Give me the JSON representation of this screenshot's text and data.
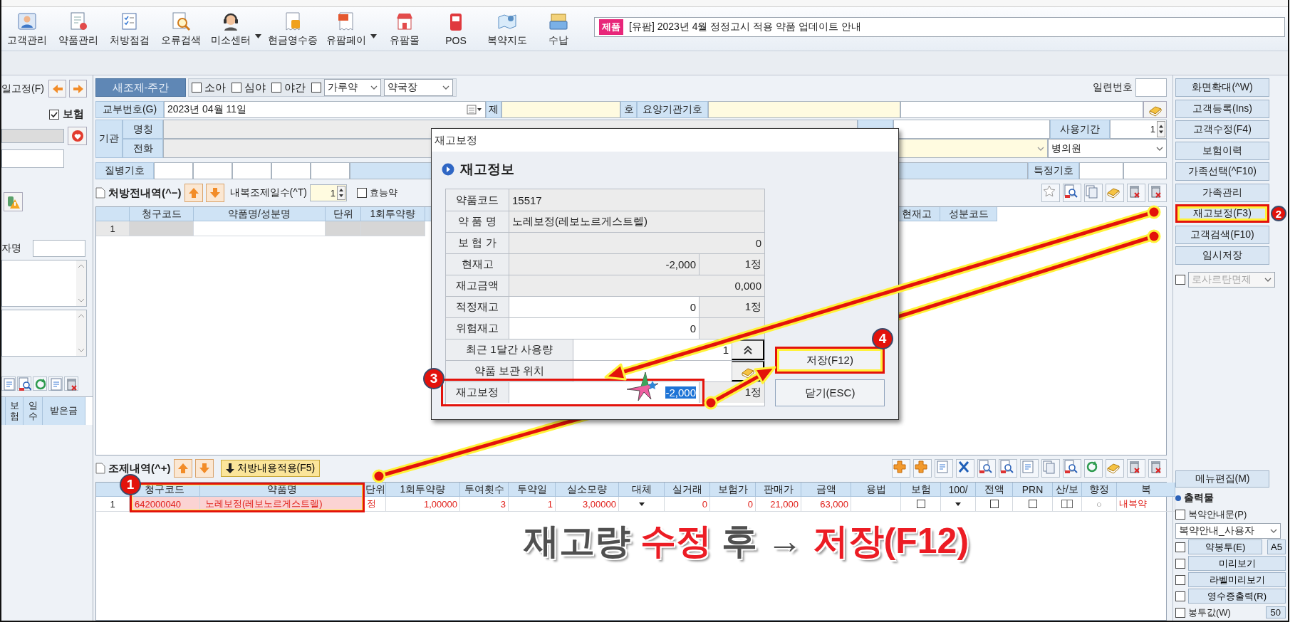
{
  "toolbar": {
    "items": [
      {
        "label": "고객관리",
        "dropdown": false
      },
      {
        "label": "약품관리",
        "dropdown": false
      },
      {
        "label": "처방점검",
        "dropdown": false
      },
      {
        "label": "오류검색",
        "dropdown": false
      },
      {
        "label": "미소센터",
        "dropdown": true
      },
      {
        "label": "현금영수증",
        "dropdown": false
      },
      {
        "label": "유팜페이",
        "dropdown": true
      },
      {
        "label": "유팜몰",
        "dropdown": false
      },
      {
        "label": "POS",
        "dropdown": false
      },
      {
        "label": "복약지도",
        "dropdown": false
      },
      {
        "label": "수납",
        "dropdown": false
      }
    ],
    "notice": {
      "badge": "제품",
      "text": "[유팜] 2023년 4월 정정고시 적용 약품 업데이트 안내"
    }
  },
  "left_panel": {
    "fix_label": "일고정(F)",
    "insurance": {
      "label": "보험",
      "checked": true
    },
    "name_label": "자명",
    "table_columns": [
      "보험",
      "일수",
      "받은금"
    ]
  },
  "form": {
    "shift_button": "새조제-주간",
    "checks": [
      {
        "label": "소아",
        "checked": false
      },
      {
        "label": "심야",
        "checked": false
      },
      {
        "label": "야간",
        "checked": false
      }
    ],
    "extra_check": {
      "checked": false
    },
    "powder_select": "가루약",
    "pharmacist_select": "약국장",
    "serial_label": "일련번호",
    "issue_label": "교부번호(G)",
    "issue_date": "2023년 04월 11일",
    "no_label": "제",
    "ho_label": "호",
    "inst_code_label": "요양기관기호",
    "inst_label": "기관",
    "inst_rows": [
      "명칭",
      "전화"
    ],
    "period_label": "사용기간",
    "period_value": "1",
    "hospital_select": "병의원",
    "disease_label": "질병기호",
    "special_label": "특정기호"
  },
  "prescription": {
    "title": "처방전내역(^−)",
    "days_label": "내복조제일수(^T)",
    "days_value": "1",
    "efficacy": {
      "label": "효능약",
      "checked": false
    },
    "columns": [
      "청구코드",
      "약품명/성분명",
      "단위",
      "1회투약량",
      "현재고",
      "성분코드"
    ],
    "rows": [
      {
        "no": "1"
      }
    ]
  },
  "dispense": {
    "title": "조제내역(^+)",
    "apply_button": "처방내용적용(F5)",
    "marker": "1",
    "columns": [
      {
        "label": "청구코드",
        "highlighted": true
      },
      {
        "label": "약품명",
        "highlighted": true
      },
      {
        "label": "단위",
        "highlighted": false
      },
      {
        "label": "1회투약량",
        "highlighted": false
      },
      {
        "label": "투여횟수",
        "highlighted": false
      },
      {
        "label": "투약일",
        "highlighted": false
      },
      {
        "label": "실소모량",
        "highlighted": false
      },
      {
        "label": "대체",
        "highlighted": false
      },
      {
        "label": "실거래",
        "highlighted": false
      },
      {
        "label": "보험가",
        "highlighted": false
      },
      {
        "label": "판매가",
        "highlighted": false
      },
      {
        "label": "금액",
        "highlighted": false
      },
      {
        "label": "용법",
        "highlighted": false
      },
      {
        "label": "보험",
        "highlighted": false
      },
      {
        "label": "100/",
        "highlighted": false
      },
      {
        "label": "전액",
        "highlighted": false
      },
      {
        "label": "PRN",
        "highlighted": false
      },
      {
        "label": "산/보",
        "highlighted": false
      },
      {
        "label": "향정",
        "highlighted": false
      },
      {
        "label": "복",
        "highlighted": false
      }
    ],
    "rows": [
      {
        "no": "1",
        "cells": [
          {
            "kind": "text",
            "text": "642000040"
          },
          {
            "kind": "text",
            "text": "노레보정(레보노르게스트렐)"
          },
          {
            "kind": "text",
            "text": "정"
          },
          {
            "kind": "number",
            "text": "1,00000"
          },
          {
            "kind": "number",
            "text": "3"
          },
          {
            "kind": "number",
            "text": "1"
          },
          {
            "kind": "number",
            "text": "3,00000"
          },
          {
            "kind": "dropdown"
          },
          {
            "kind": "number",
            "text": "0"
          },
          {
            "kind": "number",
            "text": "0"
          },
          {
            "kind": "number",
            "text": "21,000"
          },
          {
            "kind": "number",
            "text": "63,000"
          },
          {
            "kind": "empty"
          },
          {
            "kind": "checkbox",
            "checked": false
          },
          {
            "kind": "dropdown"
          },
          {
            "kind": "checkbox",
            "checked": false
          },
          {
            "kind": "checkbox",
            "checked": false
          },
          {
            "kind": "split"
          },
          {
            "kind": "symbol",
            "text": "○"
          },
          {
            "kind": "text",
            "text": "내복약"
          }
        ]
      }
    ]
  },
  "caption": "재고량 **수정** 후 → **저장(F12)**",
  "side_panel": {
    "buttons": [
      {
        "label": "화면확대(^W)",
        "highlighted": false
      },
      {
        "label": "고객등록(Ins)",
        "highlighted": false
      },
      {
        "label": "고객수정(F4)",
        "highlighted": false
      },
      {
        "label": "보험이력",
        "highlighted": false
      },
      {
        "label": "가족선택(^F10)",
        "highlighted": false
      },
      {
        "label": "가족관리",
        "highlighted": false
      },
      {
        "label": "재고보정(F3)",
        "highlighted": true,
        "marker": "2"
      },
      {
        "label": "고객검색(F10)",
        "highlighted": false
      },
      {
        "label": "임시저장",
        "highlighted": false
      }
    ],
    "exempt": {
      "label": "로사르탄면제",
      "checked": false,
      "disabled": true
    },
    "menu_edit": "메뉴편집(M)",
    "output_title": "출력물",
    "outputs": [
      {
        "kind": "check",
        "label": "복약안내문(P)",
        "checked": false
      },
      {
        "kind": "select",
        "label": "복약안내_사용자"
      },
      {
        "kind": "check_button",
        "label": "약봉투(E)",
        "checked": false,
        "extra": "A5"
      },
      {
        "kind": "check_button",
        "label": "미리보기",
        "checked": false
      },
      {
        "kind": "check_button",
        "label": "라벨미리보기",
        "checked": false
      },
      {
        "kind": "check_button",
        "label": "영수증출력(R)",
        "checked": false
      },
      {
        "kind": "check",
        "label": "봉투값(W)",
        "checked": false,
        "extra": "50"
      }
    ]
  },
  "dialog": {
    "title": "재고보정",
    "section": "재고정보",
    "rows": [
      {
        "label": "약품코드",
        "value": "15517",
        "kind": "text",
        "editable": false,
        "text_selected": false,
        "highlighted": false
      },
      {
        "label": "약 품 명",
        "value": "노레보정(레보노르게스트렐)",
        "kind": "text",
        "editable": false,
        "text_selected": false,
        "highlighted": false
      },
      {
        "label": "보 험 가",
        "value": "0",
        "kind": "number",
        "editable": false,
        "text_selected": false,
        "highlighted": false
      },
      {
        "label": "현재고",
        "value": "-2,000",
        "kind": "number",
        "editable": false,
        "unit": "1정",
        "text_selected": false,
        "highlighted": false
      },
      {
        "label": "재고금액",
        "value": "0,000",
        "kind": "number",
        "editable": false,
        "text_selected": false,
        "highlighted": false
      },
      {
        "label": "적정재고",
        "value": "0",
        "kind": "number",
        "editable": true,
        "unit": "1정",
        "text_selected": false,
        "highlighted": false
      },
      {
        "label": "위험재고",
        "value": "0",
        "kind": "number",
        "editable": true,
        "text_selected": false,
        "highlighted": false
      },
      {
        "label": "최근 1달간 사용량",
        "value": "1",
        "kind": "usage",
        "editable": true,
        "text_selected": false,
        "highlighted": false
      },
      {
        "label": "약품 보관 위치",
        "kind": "location",
        "editable": true,
        "text_selected": false,
        "highlighted": false
      },
      {
        "label": "재고보정",
        "value": "-2,000",
        "kind": "number",
        "editable": true,
        "unit": "1정",
        "text_selected": true,
        "highlighted": true,
        "marker": "3"
      }
    ],
    "buttons": [
      {
        "label": "저장(F12)",
        "highlighted": true,
        "marker": "4"
      },
      {
        "label": "닫기(ESC)",
        "highlighted": false
      }
    ]
  }
}
